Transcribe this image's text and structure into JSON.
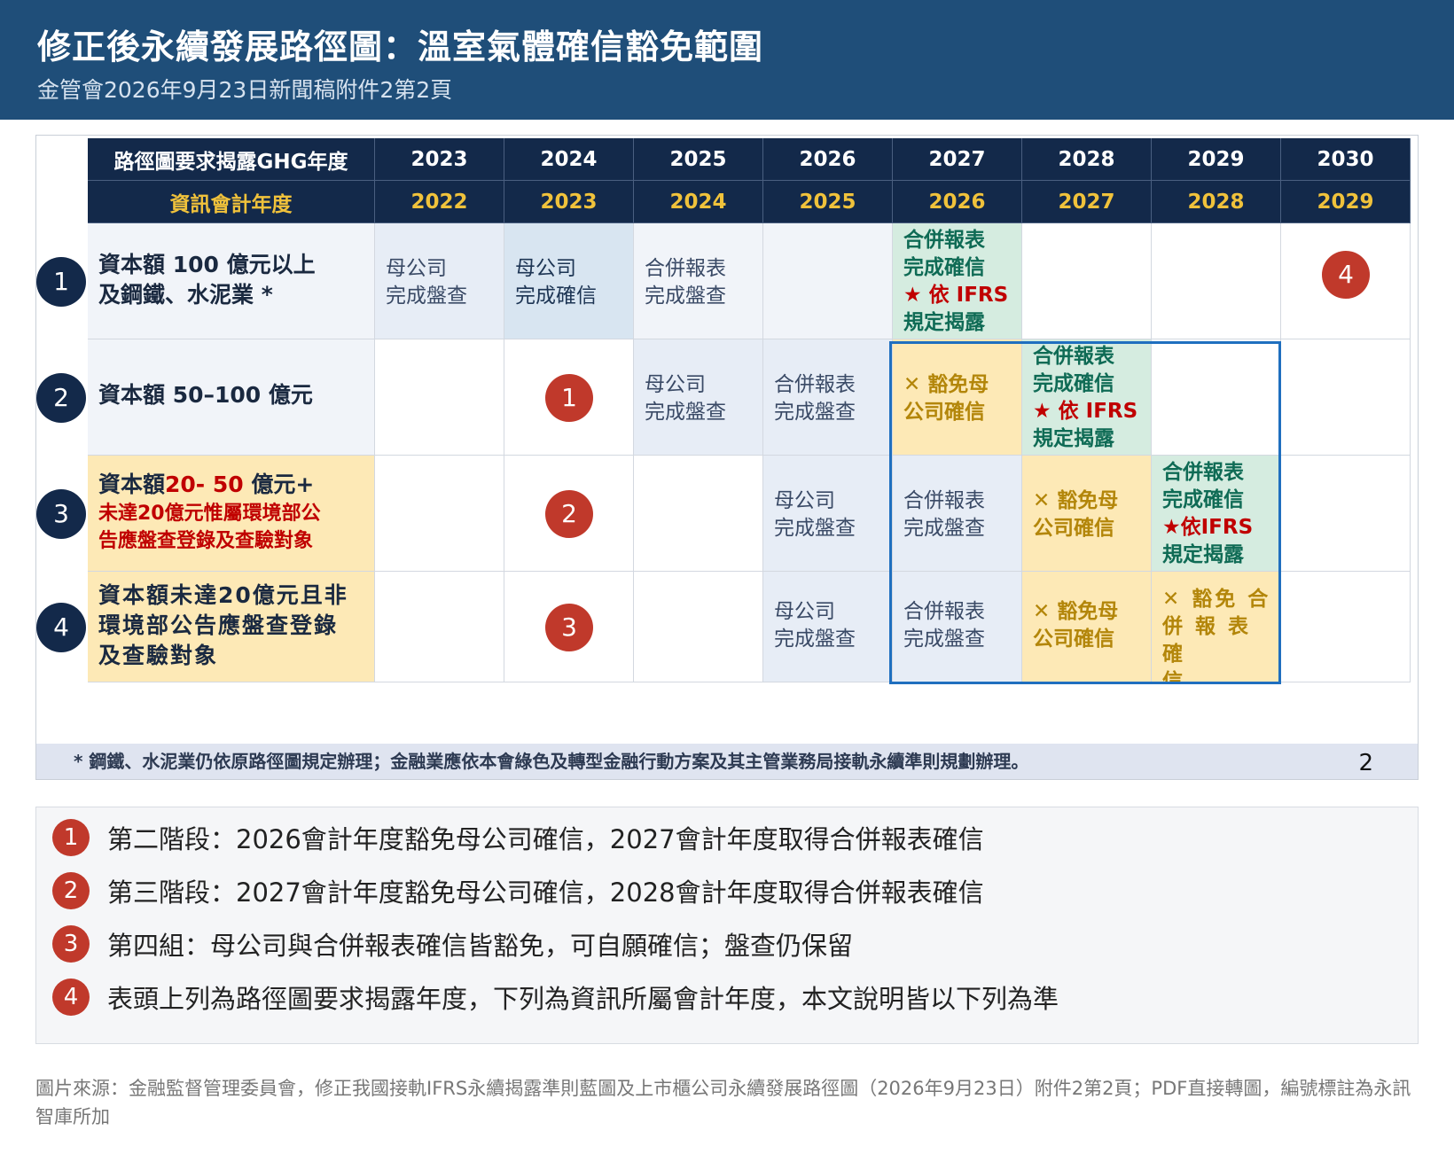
{
  "header": {
    "title": "修正後永續發展路徑圖：溫室氣體確信豁免範圍",
    "subtitle": "金管會2026年9月23日新聞稿附件2第2頁"
  },
  "table": {
    "header_row1_label": "路徑圖要求揭露GHG年度",
    "header_row2_label": "資訊會計年度",
    "disclosure_years": [
      "2023",
      "2024",
      "2025",
      "2026",
      "2027",
      "2028",
      "2029",
      "2030"
    ],
    "accounting_years": [
      "2022",
      "2023",
      "2024",
      "2025",
      "2026",
      "2027",
      "2028",
      "2029"
    ],
    "rows": [
      {
        "marker": "1",
        "label_lines": [
          "資本額 100 億元以上",
          "及鋼鐵、水泥業 *"
        ],
        "cells": [
          [
            "母公司",
            "完成盤查"
          ],
          [
            "母公司",
            "完成確信"
          ],
          [
            "合併報表",
            "完成盤查"
          ],
          [],
          [
            "合併報表",
            "完成確信",
            "★ 依 IFRS",
            "規定揭露"
          ],
          [],
          [],
          []
        ],
        "red_marker_text": "4"
      },
      {
        "marker": "2",
        "label_lines": [
          "資本額 50–100 億元"
        ],
        "cells": [
          [],
          [],
          [
            "母公司",
            "完成盤查"
          ],
          [
            "合併報表",
            "完成盤查"
          ],
          [
            "✕ 豁免母",
            "公司確信"
          ],
          [
            "合併報表",
            "完成確信",
            "★ 依 IFRS",
            "規定揭露"
          ],
          [],
          []
        ],
        "red_marker_text": "1"
      },
      {
        "marker": "3",
        "label_main": "資本額",
        "label_red": "20- 50",
        "label_tail": " 億元+",
        "label_sub_lines": [
          "未達20億元惟屬環境部公",
          "告應盤查登錄及查驗對象"
        ],
        "cells": [
          [],
          [],
          [],
          [
            "母公司",
            "完成盤查"
          ],
          [
            "合併報表",
            "完成盤查"
          ],
          [
            "✕ 豁免母",
            "公司確信"
          ],
          [
            "合併報表",
            "完成確信",
            "★依IFRS",
            "規定揭露"
          ],
          []
        ],
        "red_marker_text": "2"
      },
      {
        "marker": "4",
        "label_lines": [
          "資本額未達20億元且非",
          "環境部公告應盤查登錄",
          "及查驗對象"
        ],
        "cells": [
          [],
          [],
          [],
          [
            "母公司",
            "完成盤查"
          ],
          [
            "合併報表",
            "完成盤查"
          ],
          [
            "✕ 豁免母",
            "公司確信"
          ],
          [
            "✕ 豁免 合",
            "併 報 表 確",
            "信"
          ],
          []
        ],
        "red_marker_text": "3"
      }
    ],
    "footnote": "* 鋼鐵、水泥業仍依原路徑圖規定辦理；金融業應依本會綠色及轉型金融行動方案及其主管業務局接軌永續準則規劃辦理。",
    "page_number": "2"
  },
  "legend": [
    {
      "badge": "1",
      "text": "第二階段：2026會計年度豁免母公司確信，2027會計年度取得合併報表確信"
    },
    {
      "badge": "2",
      "text": "第三階段：2027會計年度豁免母公司確信，2028會計年度取得合併報表確信"
    },
    {
      "badge": "3",
      "text": "第四組：母公司與合併報表確信皆豁免，可自願確信；盤查仍保留"
    },
    {
      "badge": "4",
      "text": "表頭上列為路徑圖要求揭露年度，下列為資訊所屬會計年度，本文說明皆以下列為準"
    }
  ],
  "source": "圖片來源：金融監督管理委員會，修正我國接軌IFRS永續揭露準則藍圖及上市櫃公司永續發展路徑圖（2026年9月23日）附件2第2頁；PDF直接轉圖，編號標註為永訊智庫所加",
  "colors": {
    "header_bg": "#1f4e79",
    "table_header_bg": "#13294a",
    "year_gold": "#f0c23b",
    "marker_red": "#c0392b",
    "exempt_box": "#1f6fbf"
  }
}
